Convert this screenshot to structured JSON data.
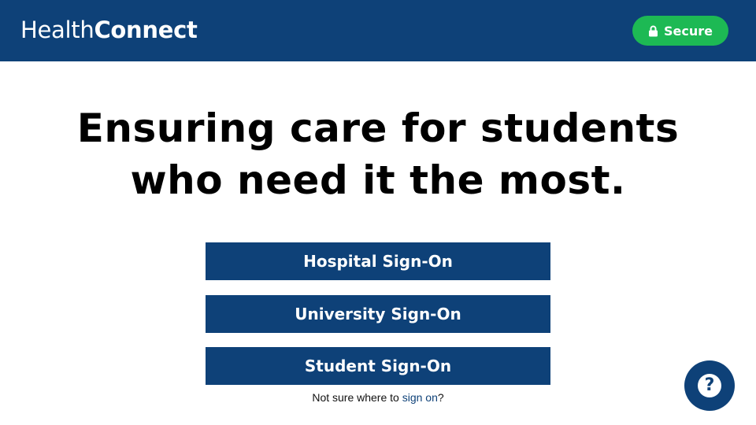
{
  "header": {
    "logo_light": "Health",
    "logo_bold": "Connect",
    "secure_label": "Secure",
    "secure_icon": "lock-icon"
  },
  "hero": {
    "line1": "Ensuring care for students",
    "line2": "who need it the most."
  },
  "signon": {
    "hospital_label": "Hospital Sign-On",
    "university_label": "University Sign-On",
    "student_label": "Student Sign-On"
  },
  "helper": {
    "prefix": "Not sure where to ",
    "link": "sign on",
    "suffix": "?"
  },
  "help_button": {
    "icon": "help-icon",
    "glyph": "?"
  },
  "colors": {
    "brand_navy": "#0e4178",
    "secure_green": "#1db954"
  }
}
